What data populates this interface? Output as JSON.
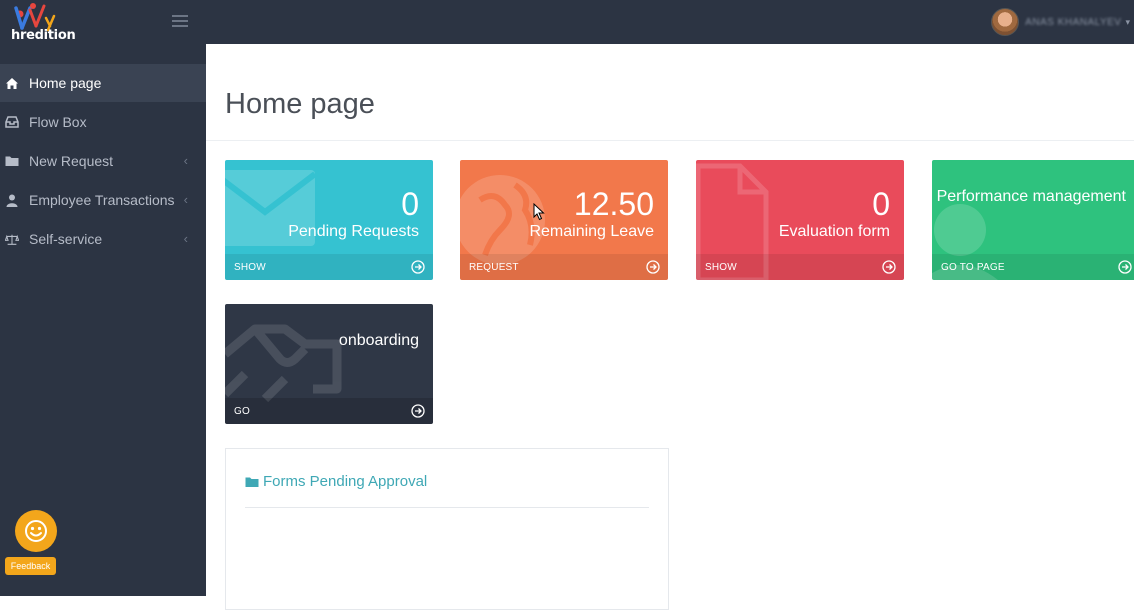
{
  "brand": {
    "logo_text": "hredition"
  },
  "header": {
    "user_name": "ANAS KHANALYEV"
  },
  "sidebar": {
    "items": [
      {
        "label": "Home page",
        "icon": "home-icon",
        "active": true,
        "has_submenu": false
      },
      {
        "label": "Flow Box",
        "icon": "inbox-icon",
        "active": false,
        "has_submenu": false
      },
      {
        "label": "New Request",
        "icon": "folder-icon",
        "active": false,
        "has_submenu": true
      },
      {
        "label": "Employee Transactions",
        "icon": "user-icon",
        "active": false,
        "has_submenu": true
      },
      {
        "label": "Self-service",
        "icon": "scale-icon",
        "active": false,
        "has_submenu": true
      }
    ],
    "feedback_label": "Feedback"
  },
  "main": {
    "page_title": "Home page",
    "cards": [
      {
        "value": "0",
        "label": "Pending Requests",
        "action": "SHOW",
        "color": "#35c2d1"
      },
      {
        "value": "12.50",
        "label": "Remaining Leave",
        "action": "REQUEST",
        "color": "#f2784b"
      },
      {
        "value": "0",
        "label": "Evaluation form",
        "action": "SHOW",
        "color": "#e94b5b"
      },
      {
        "label": "Performance management",
        "action": "GO TO PAGE",
        "color": "#2ec27e"
      },
      {
        "label": "onboarding",
        "action": "GO",
        "color": "#2f3746"
      }
    ],
    "panel": {
      "title": "Forms Pending Approval"
    }
  },
  "colors": {
    "topbar": "#2c3443",
    "sidebar": "#2c3443",
    "accent": "#3fa8b5",
    "feedback": "#f3a61b"
  }
}
